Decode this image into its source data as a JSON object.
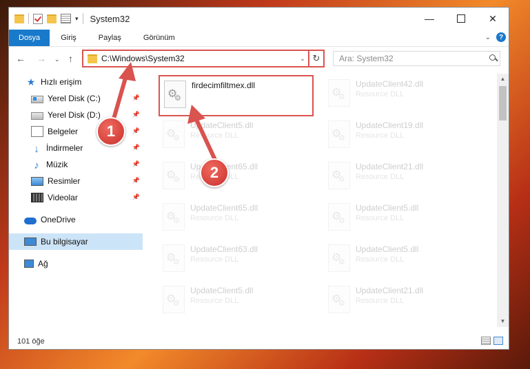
{
  "window": {
    "title": "System32",
    "controls": {
      "minimize": "—",
      "close": "✕"
    }
  },
  "ribbon": {
    "tabs": [
      "Dosya",
      "Giriş",
      "Paylaş",
      "Görünüm"
    ],
    "help": "?"
  },
  "address": {
    "path": "C:\\Windows\\System32",
    "search_placeholder": "Ara: System32"
  },
  "sidebar": {
    "items": [
      {
        "label": "Hızlı erişim",
        "icon": "star-icon",
        "pinned": false
      },
      {
        "label": "Yerel Disk (C:)",
        "icon": "drive-c-icon",
        "pinned": true
      },
      {
        "label": "Yerel Disk (D:)",
        "icon": "drive-d-icon",
        "pinned": true
      },
      {
        "label": "Belgeler",
        "icon": "documents-icon",
        "pinned": true
      },
      {
        "label": "İndirmeler",
        "icon": "downloads-icon",
        "pinned": true
      },
      {
        "label": "Müzik",
        "icon": "music-icon",
        "pinned": true
      },
      {
        "label": "Resimler",
        "icon": "pictures-icon",
        "pinned": true
      },
      {
        "label": "Videolar",
        "icon": "videos-icon",
        "pinned": true
      },
      {
        "label": "OneDrive",
        "icon": "onedrive-icon",
        "pinned": false
      },
      {
        "label": "Bu bilgisayar",
        "icon": "this-pc-icon",
        "pinned": false,
        "selected": true
      },
      {
        "label": "Ağ",
        "icon": "network-icon",
        "pinned": false
      }
    ]
  },
  "files": [
    {
      "name": "firdecimfiltmex.dll",
      "type": "",
      "highlighted": true
    },
    {
      "name": "UpdateClient42.dll",
      "type": "Resource DLL"
    },
    {
      "name": "UpdateClient5.dll",
      "type": "Resource DLL"
    },
    {
      "name": "UpdateClient19.dll",
      "type": "Resource DLL"
    },
    {
      "name": "UpdateClient65.dll",
      "type": "Resource DLL"
    },
    {
      "name": "UpdateClient21.dll",
      "type": "Resource DLL"
    },
    {
      "name": "UpdateClient65.dll",
      "type": "Resource DLL"
    },
    {
      "name": "UpdateClient5.dll",
      "type": "Resource DLL"
    },
    {
      "name": "UpdateClient63.dll",
      "type": "Resource DLL"
    },
    {
      "name": "UpdateClient5.dll",
      "type": "Resource DLL"
    },
    {
      "name": "UpdateClient5.dll",
      "type": "Resource DLL"
    },
    {
      "name": "UpdateClient21.dll",
      "type": "Resource DLL"
    }
  ],
  "status": {
    "item_count": "101 öğe"
  },
  "annotations": {
    "step1": "1",
    "step2": "2",
    "color": "#d9534f"
  }
}
